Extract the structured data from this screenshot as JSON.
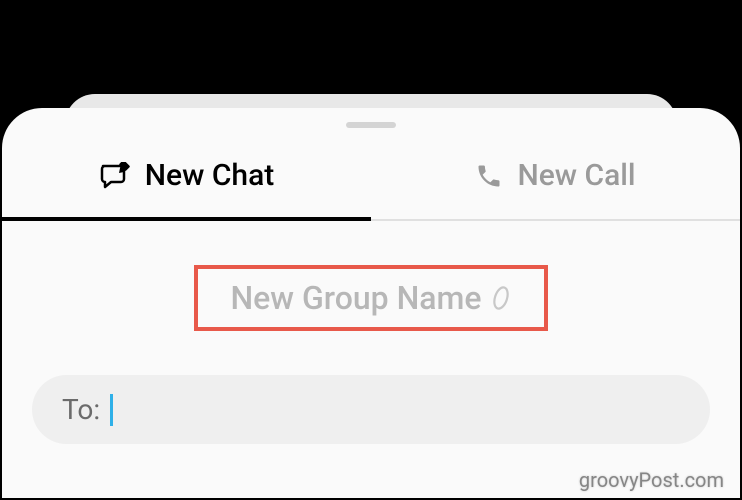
{
  "tabs": {
    "chat": {
      "label": "New Chat"
    },
    "call": {
      "label": "New Call"
    }
  },
  "group_name": {
    "placeholder": "New Group Name"
  },
  "to_field": {
    "label": "To:"
  },
  "watermark": "groovyPost.com"
}
